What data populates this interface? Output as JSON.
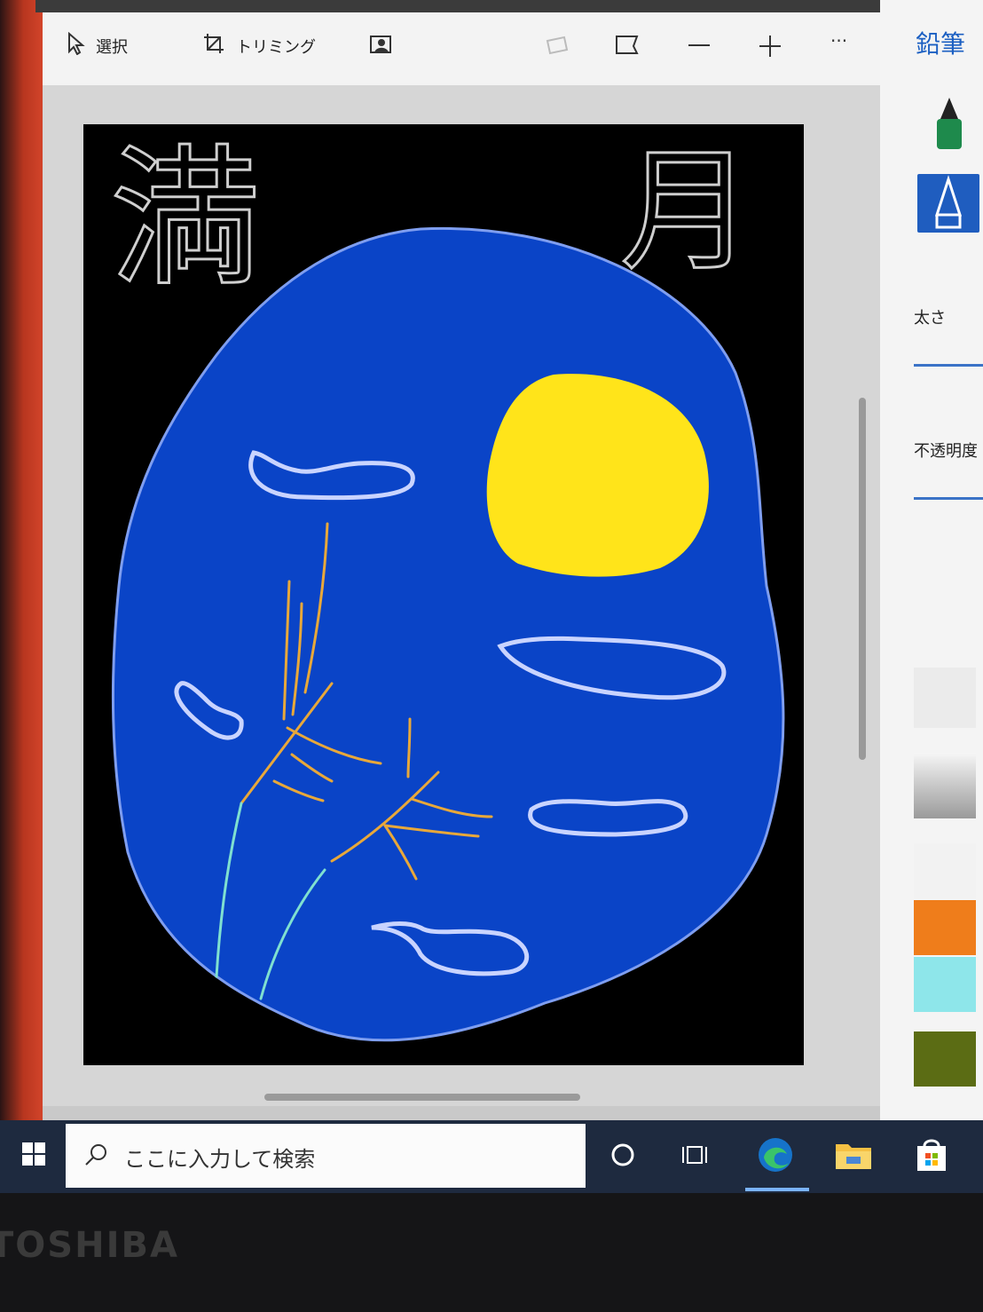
{
  "toolbar": {
    "select_label": "選択",
    "crop_label": "トリミング",
    "more_label": "···"
  },
  "side_panel": {
    "title": "鉛筆",
    "thickness_label": "太さ",
    "opacity_label": "不透明度",
    "swatches": [
      "#f2f2f2",
      "#ef7d1b",
      "#8ee6ea",
      "#5b6c14"
    ]
  },
  "taskbar": {
    "search_placeholder": "ここに入力して検索"
  },
  "device": {
    "brand": "TOSHIBA"
  },
  "drawing": {
    "text_left": "満",
    "text_right": "月",
    "colors": {
      "sky": "#0a44c7",
      "moon": "#ffe41a",
      "background": "#000000"
    }
  }
}
